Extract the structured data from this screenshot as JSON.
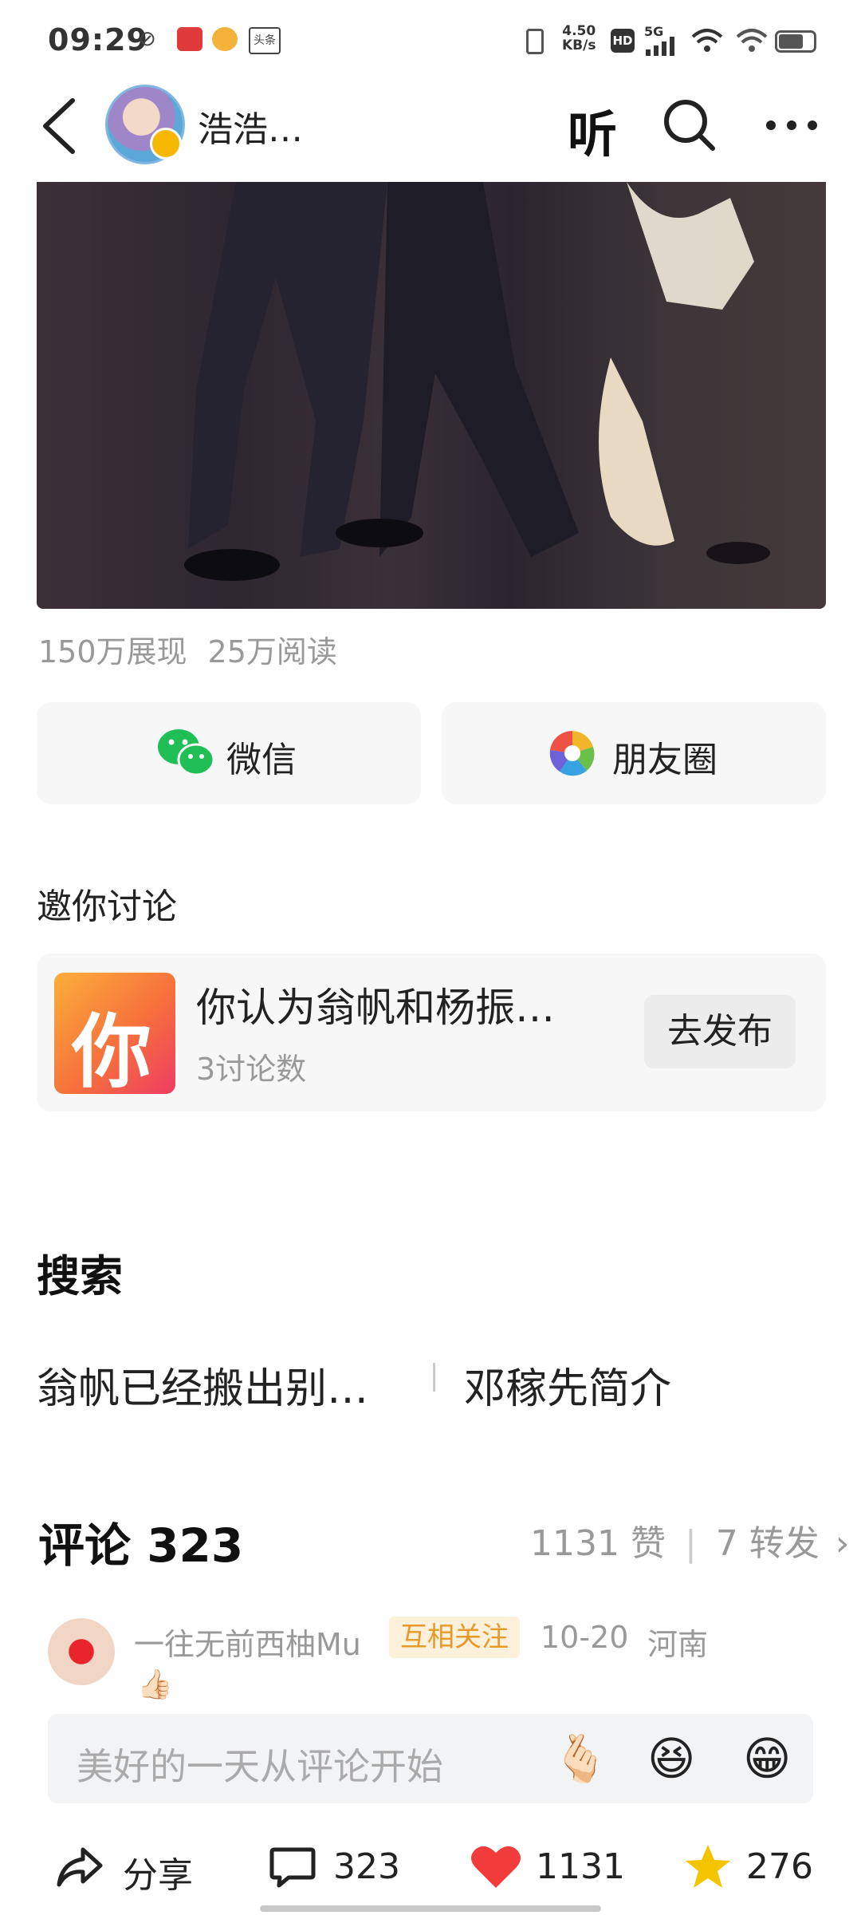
{
  "status_bar": {
    "time": "09:29",
    "net_speed_value": "4.50",
    "net_speed_unit": "KB/s",
    "hd": "HD",
    "signal": "5G",
    "app_badge": "头条"
  },
  "nav": {
    "author_name": "浩浩…",
    "listen_label": "听"
  },
  "article": {
    "impressions": "150万展现",
    "reads": "25万阅读"
  },
  "share": {
    "wechat_label": "微信",
    "moments_label": "朋友圈"
  },
  "invite": {
    "section_title": "邀你讨论",
    "topic_icon_text": "你",
    "topic_title": "你认为翁帆和杨振…",
    "topic_count": "3讨论数",
    "publish_label": "去发布"
  },
  "search": {
    "section_title": "搜索",
    "keywords": [
      "翁帆已经搬出别…",
      "邓稼先简介"
    ]
  },
  "comments": {
    "title": "评论 323",
    "likes": "1131 赞",
    "reposts": "7 转发",
    "first": {
      "user": "一往无前西柚Mu",
      "tag": "互相关注",
      "date": "10-20",
      "location": "河南",
      "content": "👍🏻"
    }
  },
  "comment_input": {
    "placeholder": "美好的一天从评论开始",
    "emojis": [
      "🫰🏻",
      "😆",
      "😁"
    ]
  },
  "bottom_bar": {
    "share_label": "分享",
    "comment_count": "323",
    "like_count": "1131",
    "favorite_count": "276"
  },
  "colors": {
    "accent_red": "#f23c3c",
    "star_yellow": "#f5c400",
    "tag_orange": "#e79a2a",
    "wechat_green": "#1fbf55"
  }
}
